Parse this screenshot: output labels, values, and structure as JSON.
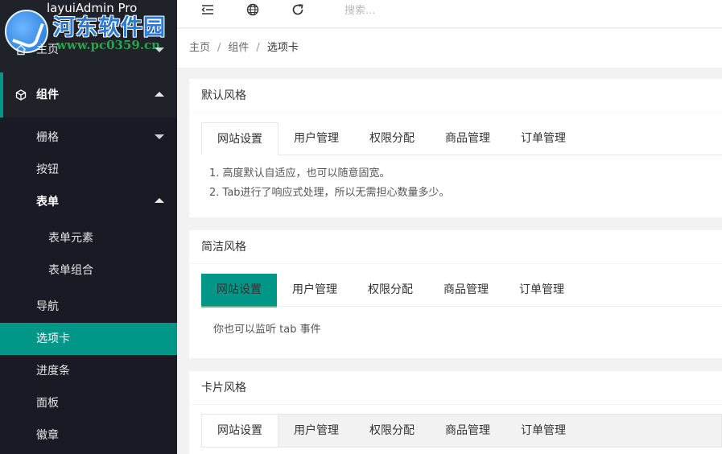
{
  "app": {
    "title": "layuiAdmin Pro"
  },
  "watermark": {
    "site_name": "河东软件园",
    "url": "www.pc0359.cn"
  },
  "sidebar": {
    "home": "主页",
    "components": "组件",
    "items": {
      "grid": "栅格",
      "button": "按钮",
      "form": "表单",
      "form_elements": "表单元素",
      "form_combo": "表单组合",
      "nav": "导航",
      "tabs": "选项卡",
      "progress": "进度条",
      "panel": "面板",
      "badge": "徽章"
    }
  },
  "header": {
    "search_placeholder": "搜索..."
  },
  "breadcrumb": {
    "home": "主页",
    "component": "组件",
    "current": "选项卡"
  },
  "cards": {
    "default": {
      "title": "默认风格",
      "tabs": [
        "网站设置",
        "用户管理",
        "权限分配",
        "商品管理",
        "订单管理"
      ],
      "lines": [
        "1. 高度默认自适应，也可以随意固宽。",
        "2. Tab进行了响应式处理，所以无需担心数量多少。"
      ]
    },
    "brief": {
      "title": "简洁风格",
      "tabs": [
        "网站设置",
        "用户管理",
        "权限分配",
        "商品管理",
        "订单管理"
      ],
      "content": "你也可以监听 tab 事件"
    },
    "card": {
      "title": "卡片风格",
      "tabs": [
        "网站设置",
        "用户管理",
        "权限分配",
        "商品管理",
        "订单管理"
      ]
    }
  }
}
